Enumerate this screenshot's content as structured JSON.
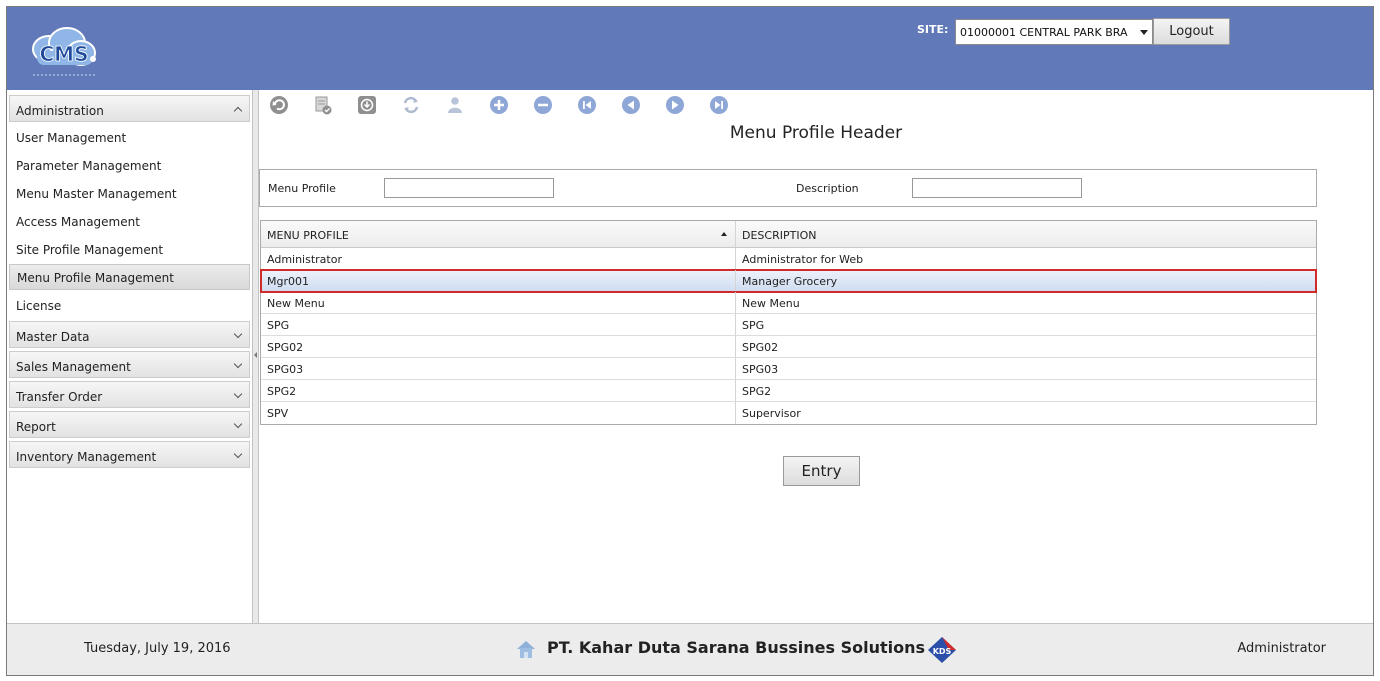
{
  "header": {
    "logo_text": "CMS",
    "site_label": "SITE:",
    "site_value": "01000001 CENTRAL PARK BRA",
    "logout_label": "Logout"
  },
  "sidebar": {
    "administration": "Administration",
    "admin_items": [
      {
        "label": "User Management"
      },
      {
        "label": "Parameter Management"
      },
      {
        "label": "Menu Master Management"
      },
      {
        "label": "Access Management"
      },
      {
        "label": "Site Profile Management"
      },
      {
        "label": "Menu Profile Management",
        "active": true
      },
      {
        "label": "License"
      }
    ],
    "sections": [
      {
        "label": "Master Data"
      },
      {
        "label": "Sales Management"
      },
      {
        "label": "Transfer Order"
      },
      {
        "label": "Report"
      },
      {
        "label": "Inventory Management"
      }
    ]
  },
  "toolbar": {
    "icons": [
      "undo-icon",
      "document-check-icon",
      "download-icon",
      "refresh-icon",
      "user-icon",
      "plus-circle-icon",
      "minus-circle-icon",
      "first-record-icon",
      "previous-record-icon",
      "next-record-icon",
      "last-record-icon"
    ]
  },
  "main": {
    "title": "Menu Profile Header",
    "filter": {
      "menu_profile_label": "Menu Profile",
      "menu_profile_value": "",
      "description_label": "Description",
      "description_value": ""
    },
    "grid": {
      "columns": [
        "MENU PROFILE",
        "DESCRIPTION"
      ],
      "rows": [
        {
          "profile": "Administrator",
          "description": "Administrator for Web"
        },
        {
          "profile": "Mgr001",
          "description": "Manager Grocery",
          "selected": true
        },
        {
          "profile": "New Menu",
          "description": "New Menu"
        },
        {
          "profile": "SPG",
          "description": "SPG"
        },
        {
          "profile": "SPG02",
          "description": "SPG02"
        },
        {
          "profile": "SPG03",
          "description": "SPG03"
        },
        {
          "profile": "SPG2",
          "description": "SPG2"
        },
        {
          "profile": "SPV",
          "description": "Supervisor"
        }
      ]
    },
    "entry_label": "Entry"
  },
  "footer": {
    "date": "Tuesday, July 19, 2016",
    "company": "PT. Kahar Duta Sarana Bussines Solutions",
    "kds_logo_text": "KDS",
    "user": "Administrator"
  },
  "colors": {
    "header_bg": "#6179b9",
    "selected_outline": "#d12a2a",
    "toolbar_icon": "#8aa0c8"
  }
}
